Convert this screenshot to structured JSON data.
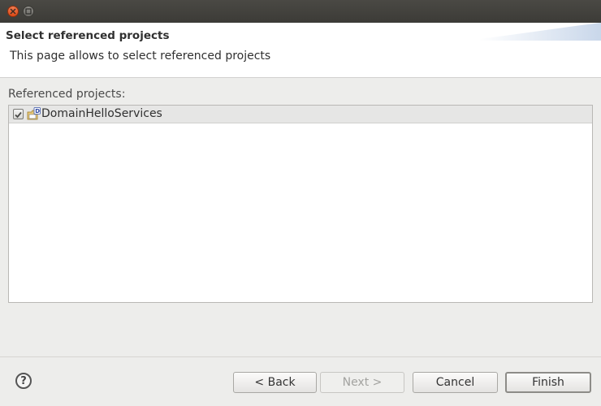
{
  "window": {
    "close_icon": "close-icon",
    "maximize_icon": "maximize-icon"
  },
  "header": {
    "title": "Select referenced projects",
    "description": "This page allows to select referenced projects"
  },
  "content": {
    "label": "Referenced projects:",
    "items": [
      {
        "label": "DomainHelloServices",
        "checked": true,
        "icon": "project-icon"
      }
    ]
  },
  "footer": {
    "help": "?",
    "back": "< Back",
    "next": "Next >",
    "cancel": "Cancel",
    "finish": "Finish"
  }
}
